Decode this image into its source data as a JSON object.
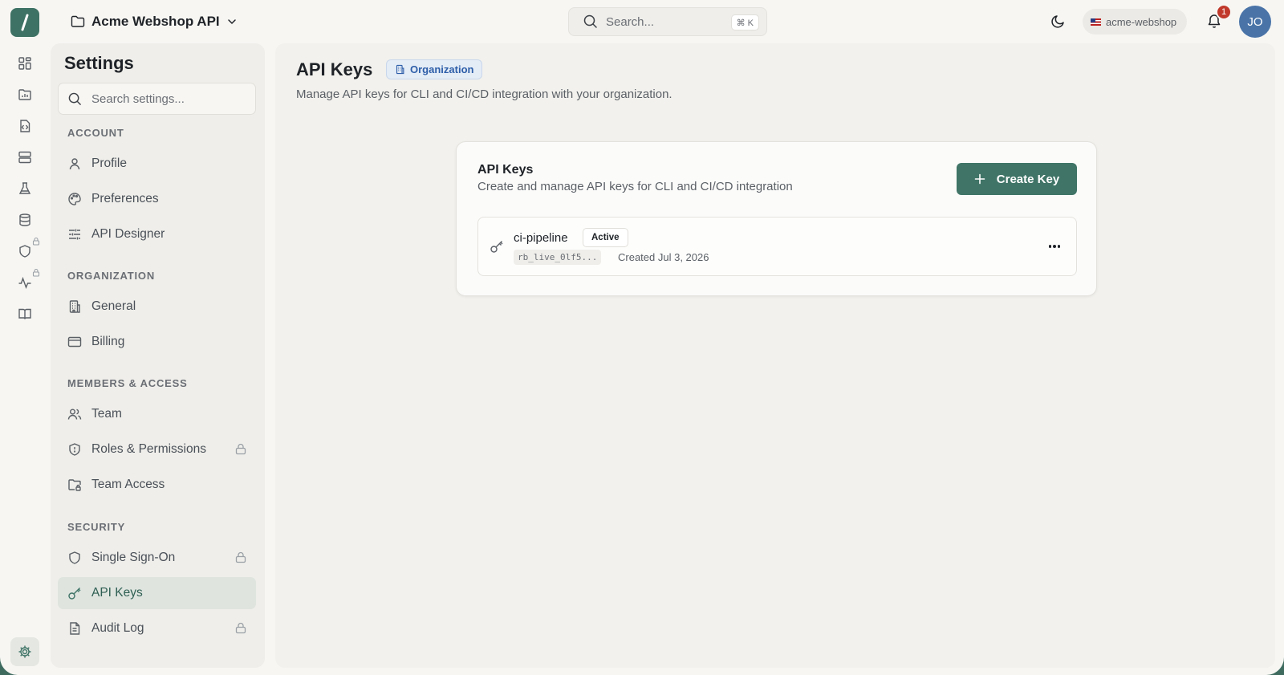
{
  "app": {
    "project_name": "Acme Webshop API",
    "search_placeholder": "Search...",
    "search_shortcut": "⌘ K",
    "org_name": "acme-webshop",
    "notification_count": "1",
    "user_initials": "JO"
  },
  "colors": {
    "brand": "#3e7264",
    "primary_button": "#3f7466",
    "notification_badge": "#c0392b",
    "avatar": "#4a74a8",
    "scope_badge_text": "#2d5ea8"
  },
  "rail": {
    "items": [
      {
        "icon": "dashboard-icon"
      },
      {
        "icon": "folder-chart-icon"
      },
      {
        "icon": "code-file-icon"
      },
      {
        "icon": "server-icon"
      },
      {
        "icon": "flask-icon"
      },
      {
        "icon": "database-icon"
      },
      {
        "icon": "shield-icon",
        "locked": true
      },
      {
        "icon": "activity-icon",
        "locked": true
      },
      {
        "icon": "book-icon"
      }
    ],
    "settings_icon": "gear-icon"
  },
  "settings": {
    "title": "Settings",
    "search_placeholder": "Search settings...",
    "sections": [
      {
        "label": "ACCOUNT",
        "items": [
          {
            "label": "Profile",
            "icon": "user-icon"
          },
          {
            "label": "Preferences",
            "icon": "palette-icon"
          },
          {
            "label": "API Designer",
            "icon": "sliders-icon"
          }
        ]
      },
      {
        "label": "ORGANIZATION",
        "items": [
          {
            "label": "General",
            "icon": "building-icon"
          },
          {
            "label": "Billing",
            "icon": "credit-card-icon"
          }
        ]
      },
      {
        "label": "MEMBERS & ACCESS",
        "items": [
          {
            "label": "Team",
            "icon": "users-icon"
          },
          {
            "label": "Roles & Permissions",
            "icon": "shield-icon",
            "locked": true
          },
          {
            "label": "Team Access",
            "icon": "folder-lock-icon"
          }
        ]
      },
      {
        "label": "SECURITY",
        "items": [
          {
            "label": "Single Sign-On",
            "icon": "shield-icon",
            "locked": true
          },
          {
            "label": "API Keys",
            "icon": "key-icon",
            "active": true
          },
          {
            "label": "Audit Log",
            "icon": "document-icon",
            "locked": true
          }
        ]
      }
    ]
  },
  "main": {
    "title": "API Keys",
    "scope_badge": "Organization",
    "description": "Manage API keys for CLI and CI/CD integration with your organization.",
    "card": {
      "title": "API Keys",
      "description": "Create and manage API keys for CLI and CI/CD integration",
      "create_button": "Create Key",
      "keys": [
        {
          "name": "ci-pipeline",
          "status": "Active",
          "prefix": "rb_live_0lf5...",
          "created": "Created Jul 3, 2026"
        }
      ]
    }
  }
}
